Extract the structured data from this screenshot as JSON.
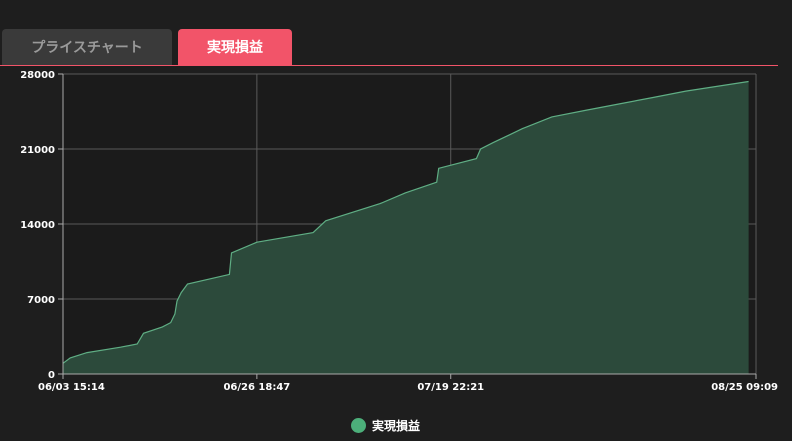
{
  "tabs": [
    {
      "label": "プライスチャート",
      "active": false
    },
    {
      "label": "実現損益",
      "active": true
    }
  ],
  "colors": {
    "accent": "#f25469",
    "area_fill": "#2c4a3b",
    "area_line": "#5fae84",
    "grid": "#5a5a5a",
    "legend_dot": "#4caf7a"
  },
  "chart_data": {
    "type": "area",
    "title": "",
    "xlabel": "",
    "ylabel": "",
    "ylim": [
      0,
      28000
    ],
    "yticks": [
      "0",
      "7000",
      "14000",
      "21000",
      "28000"
    ],
    "xticks": [
      "06/03 15:14",
      "06/26 18:47",
      "07/19 22:21",
      "08/25 09:09"
    ],
    "grid": true,
    "legend_position": "bottom-center",
    "series": [
      {
        "name": "実現損益",
        "x": [
          "06/03 15:14",
          "06/04 12:00",
          "06/06 12:00",
          "06/10 12:00",
          "06/12 12:00",
          "06/13 06:00",
          "06/15 12:00",
          "06/16 12:00",
          "06/17 00:00",
          "06/17 06:00",
          "06/17 18:00",
          "06/18 12:00",
          "06/23 12:00",
          "06/23 18:00",
          "06/26 18:47",
          "07/03 12:00",
          "07/05 00:00",
          "07/11 12:00",
          "07/14 12:00",
          "07/18 06:00",
          "07/18 12:00",
          "07/23 00:00",
          "07/23 12:00",
          "07/25 00:00",
          "07/28 12:00",
          "08/01 00:00",
          "08/05 00:00",
          "08/09 00:00",
          "08/13 00:00",
          "08/17 00:00",
          "08/24 12:00"
        ],
        "values": [
          1000,
          1500,
          2000,
          2500,
          2800,
          3800,
          4400,
          4800,
          5600,
          6800,
          7600,
          8400,
          9300,
          11300,
          12300,
          13200,
          14300,
          15900,
          16900,
          17900,
          19200,
          20100,
          21000,
          21600,
          22900,
          24000,
          24600,
          25200,
          25800,
          26400,
          27300
        ]
      }
    ]
  },
  "legend": {
    "label": "実現損益"
  }
}
